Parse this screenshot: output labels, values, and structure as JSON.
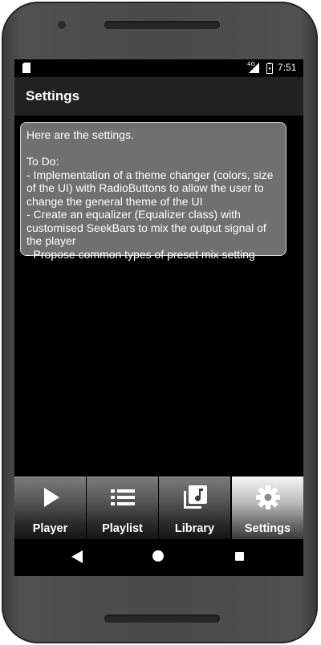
{
  "status_bar": {
    "network": "4G",
    "time": "7:51",
    "icons": [
      "sd-card-icon",
      "signal-icon",
      "battery-icon"
    ]
  },
  "app_bar": {
    "title": "Settings"
  },
  "note": {
    "intro": "Here are the settings.",
    "todo_heading": "To Do:",
    "items": [
      "- Implementation of a theme changer (colors, size of the UI) with RadioButtons to allow the user to change the general theme of the UI",
      "- Create an equalizer (Equalizer class) with customised SeekBars to mix the output signal of the player",
      "- Propose common types of preset mix setting"
    ]
  },
  "bottom_nav": {
    "items": [
      {
        "label": "Player",
        "icon": "play-icon",
        "active": false
      },
      {
        "label": "Playlist",
        "icon": "list-icon",
        "active": false
      },
      {
        "label": "Library",
        "icon": "music-library-icon",
        "active": false
      },
      {
        "label": "Settings",
        "icon": "gear-icon",
        "active": true
      }
    ]
  },
  "system_nav": {
    "buttons": [
      "back-icon",
      "home-icon",
      "recents-icon"
    ]
  }
}
